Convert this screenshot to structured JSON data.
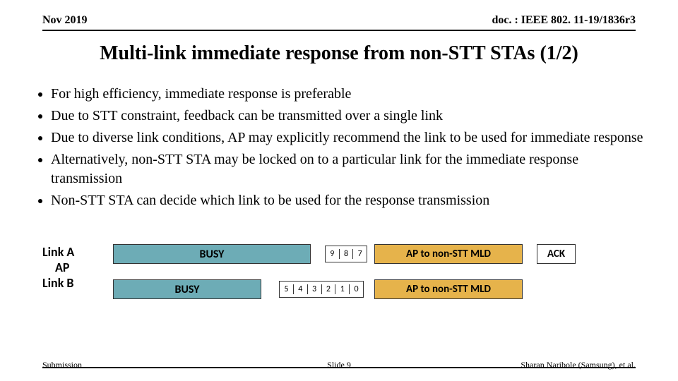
{
  "header": {
    "date": "Nov 2019",
    "doc": "doc. : IEEE 802. 11-19/1836r3"
  },
  "title": "Multi-link immediate response from non-STT STAs (1/2)",
  "bullets": [
    "For high efficiency, immediate response is preferable",
    "Due to STT constraint, feedback can be transmitted over a single link",
    "Due to diverse link conditions, AP may explicitly recommend the link to be used for immediate response",
    "Alternatively, non-STT STA may be locked on to a particular link for the immediate response transmission",
    "Non-STT STA can decide which link to be used for the response transmission"
  ],
  "diagram": {
    "ap": "AP",
    "linkA": {
      "label": "Link A",
      "busy": "BUSY",
      "count": [
        "9",
        "8",
        "7"
      ],
      "frame": "AP to non-STT MLD",
      "ack": "ACK"
    },
    "linkB": {
      "label": "Link B",
      "busy": "BUSY",
      "count": [
        "5",
        "4",
        "3",
        "2",
        "1",
        "0"
      ],
      "frame": "AP to non-STT MLD"
    }
  },
  "footer": {
    "sub": "Submission",
    "slide": "Slide 9",
    "author": "Sharan Naribole (Samsung), et al."
  }
}
